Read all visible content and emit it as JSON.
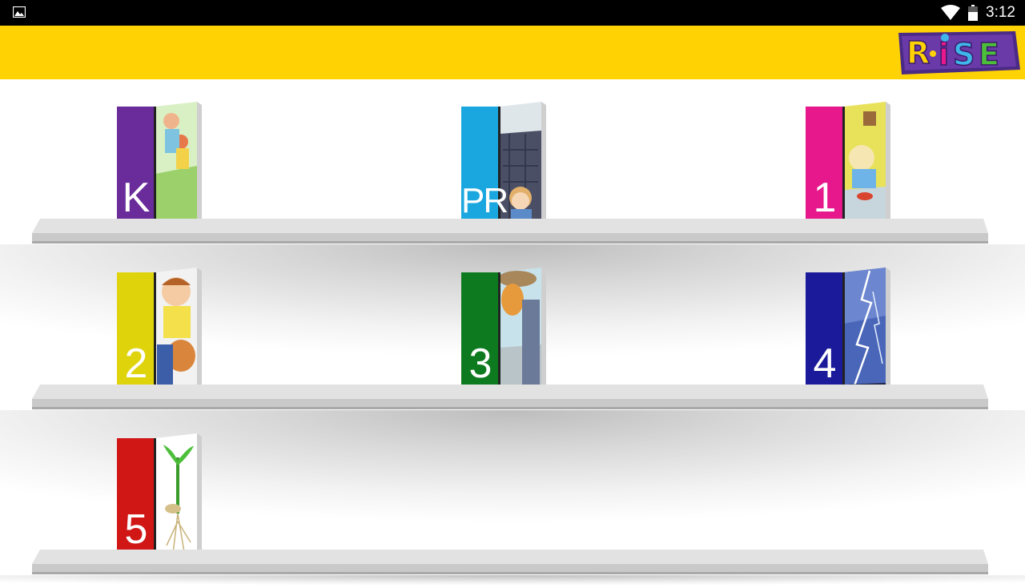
{
  "status_bar": {
    "time": "3:12",
    "left_icon": "image-icon",
    "icons": [
      "wifi-icon",
      "battery-icon"
    ]
  },
  "header": {
    "background": "#ffd204",
    "logo_text": "R·iSE",
    "logo_icon": "rise-logo"
  },
  "shelves": [
    {
      "books": [
        {
          "label": "K",
          "spine_color": "#6a2c9a",
          "cover": "kids-playground"
        },
        {
          "label": "PR",
          "spine_color": "#1aa7df",
          "cover": "stone-wall-boy"
        },
        {
          "label": "1",
          "spine_color": "#e6188c",
          "cover": "cartoon-character"
        }
      ]
    },
    {
      "books": [
        {
          "label": "2",
          "spine_color": "#dfd40c",
          "cover": "boy-with-dog"
        },
        {
          "label": "3",
          "spine_color": "#0e7a1f",
          "cover": "girl-with-hat"
        },
        {
          "label": "4",
          "spine_color": "#1a1a9a",
          "cover": "lightning"
        }
      ]
    },
    {
      "books": [
        {
          "label": "5",
          "spine_color": "#d11616",
          "cover": "seedling"
        }
      ]
    }
  ]
}
